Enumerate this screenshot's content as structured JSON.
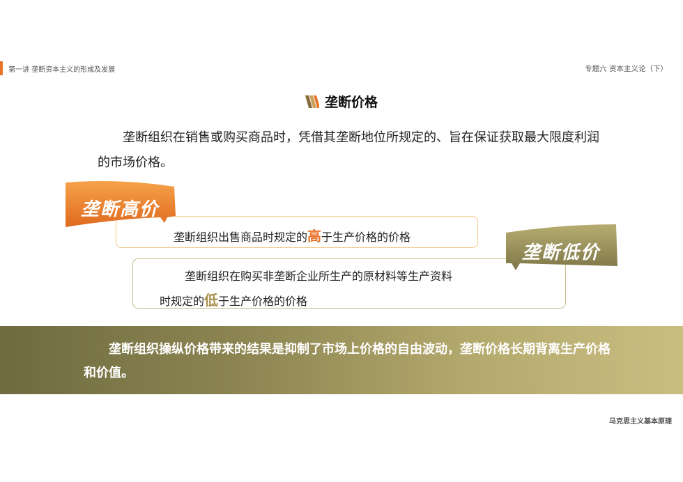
{
  "header": {
    "left": "第一讲 垄断资本主义的形成及发展",
    "right": "专题六 资本主义论（下）"
  },
  "title": "垄断价格",
  "definition": "垄断组织在销售或购买商品时，凭借其垄断地位所规定的、旨在保证获取最大限度利润的市场价格。",
  "high_price": {
    "tag": "垄断高价",
    "text_before": "垄断组织出售商品时规定的",
    "highlight": "高",
    "text_after": "于生产价格的价格"
  },
  "low_price": {
    "tag": "垄断低价",
    "line1": "垄断组织在购买非垄断企业所生产的原材料等生产资料",
    "line2_before": "时规定的",
    "highlight": "低",
    "line2_after": "于生产价格的价格"
  },
  "conclusion": "垄断组织操纵价格带来的结果是抑制了市场上价格的自由波动，垄断价格长期背离生产价格和价值。",
  "footer": "马克思主义基本原理",
  "colors": {
    "accent_orange": "#e8732b",
    "accent_olive": "#8c8552"
  }
}
